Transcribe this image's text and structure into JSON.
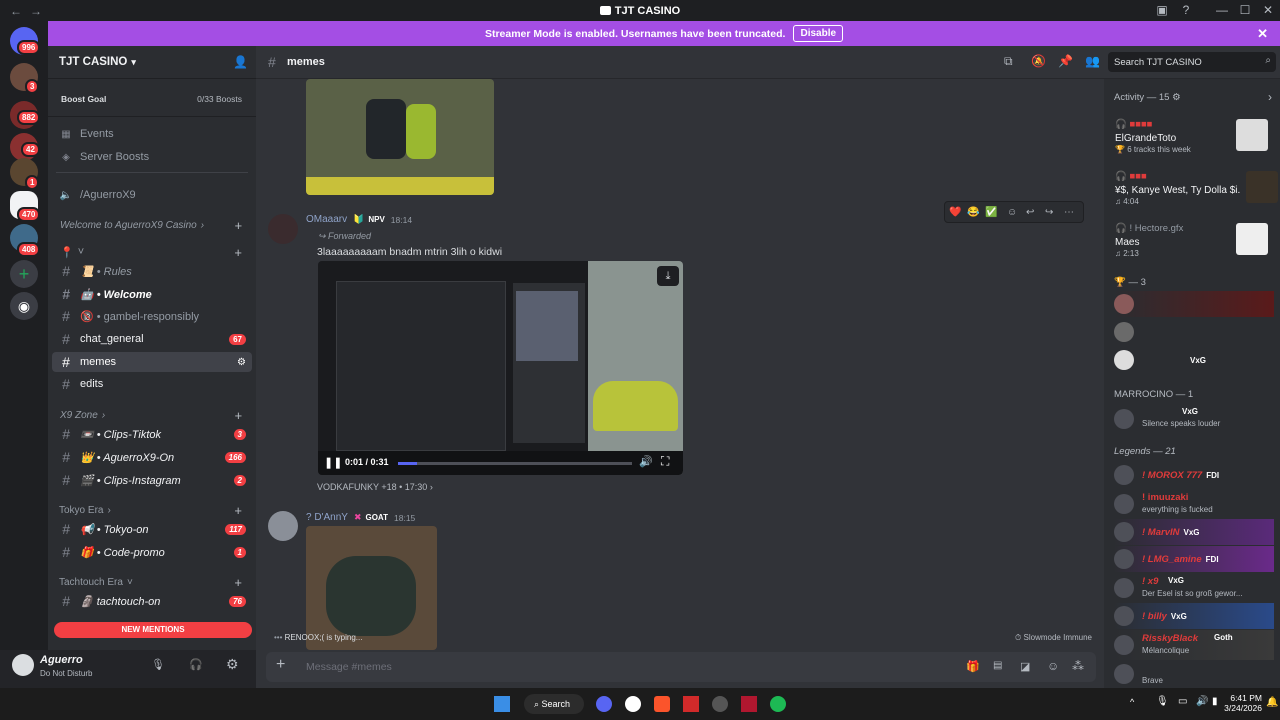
{
  "window": {
    "title": "TJT CASINO",
    "back": "←",
    "forward": "→",
    "min": "—",
    "max": "☐",
    "close": "✕"
  },
  "banner": {
    "text": "Streamer Mode is enabled. Usernames have been truncated.",
    "button": "Disable",
    "close": "✕"
  },
  "guilds": {
    "badges": [
      "996",
      "3",
      "882",
      "42",
      "1",
      "470",
      "408"
    ]
  },
  "server": {
    "name": "TJT CASINO",
    "boost_goal": "Boost Goal",
    "boost_count": "0/33 Boosts",
    "events": "Events",
    "server_boosts": "Server Boosts",
    "aguerro_link": "/AguerroX9",
    "welcome_cat": "Welcome to AguerroX9 Casino",
    "pin_cat": "📍",
    "channels": [
      {
        "name": "📜 • Rules"
      },
      {
        "name": "🤖 • Welcome"
      },
      {
        "name": "🔞 • gambel-responsibly"
      },
      {
        "name": "chat_general",
        "count": "67"
      },
      {
        "name": "memes"
      },
      {
        "name": "edits"
      }
    ],
    "x9_cat": "X9 Zone",
    "x9_channels": [
      {
        "name": "📼 • Clips-Tiktok",
        "count": "3"
      },
      {
        "name": "👑 • AguerroX9-On",
        "count": "166"
      },
      {
        "name": "🎬 • Clips-Instagram",
        "count": "2"
      }
    ],
    "tokyo_cat": "Tokyo Era",
    "tokyo_channels": [
      {
        "name": "📢 • Tokyo-on",
        "count": "117"
      },
      {
        "name": "🎁 • Code-promo",
        "count": "1"
      }
    ],
    "tach_cat": "Tachtouch Era",
    "tach_channels": [
      {
        "name": "🗿 tachtouch-on",
        "count": "76"
      }
    ],
    "new_mentions": "NEW MENTIONS"
  },
  "user": {
    "name": "Aguerro",
    "status": "Do Not Disturb"
  },
  "channel_header": {
    "name": "memes",
    "search_placeholder": "Search TJT CASINO"
  },
  "messages": [
    {
      "author": "OMaaarv",
      "badge": "NPV",
      "time": "18:14",
      "forwarded": "Forwarded",
      "text": "3laaaaaaaaam bnadm mtrin 3lih o kidwi",
      "video_time": "0:01 / 0:31",
      "footer_user": "VODKAFUNKY +18",
      "footer_time": "17:30"
    },
    {
      "author": "? D'AnnY",
      "badge": "GOAT",
      "time": "18:15"
    }
  ],
  "reactions_bar": [
    "❤️",
    "😂",
    "✅"
  ],
  "typing": "RENOOX;( is typing...",
  "slowmode": "Slowmode Immune",
  "input_placeholder": "Message #memes",
  "members": {
    "activity": "Activity — 15",
    "activities": [
      {
        "name": "ElGrandeToto",
        "detail": "6 tracks this week"
      },
      {
        "name": "¥$, Kanye West, Ty Dolla $i...",
        "detail": "4:04"
      },
      {
        "name": "Maes",
        "detail": "2:13",
        "user": "! Hectore.gfx"
      }
    ],
    "group1": "— 3",
    "group1_tag": "VxG",
    "marrocino": "MARROCINO — 1",
    "marrocino_member": {
      "tag": "VxG",
      "status": "Silence speaks louder"
    },
    "legends": "Legends — 21",
    "legend_members": [
      {
        "name": "! MOROX 777",
        "tag": "FDI",
        "status": ""
      },
      {
        "name": "! imuuzaki",
        "tag": "",
        "status": "everything is fucked"
      },
      {
        "name": "! MarvIN",
        "tag": "VxG",
        "status": ""
      },
      {
        "name": "! LMG_amine",
        "tag": "FDI",
        "status": ""
      },
      {
        "name": "! x9",
        "tag": "VxG",
        "status": "Der Esel ist so groß gewor..."
      },
      {
        "name": "! billy",
        "tag": "VxG",
        "status": ""
      },
      {
        "name": "RisskyBlack",
        "tag": "Goth",
        "status": "Mélancolique"
      },
      {
        "name": "",
        "tag": "",
        "status": "Brave"
      }
    ]
  },
  "taskbar": {
    "search": "Search",
    "time": "6:41 PM",
    "date": "3/24/2026"
  },
  "colors": {
    "accent": "#a44ee4",
    "mention": "#f23f43",
    "bg": "#313338"
  }
}
